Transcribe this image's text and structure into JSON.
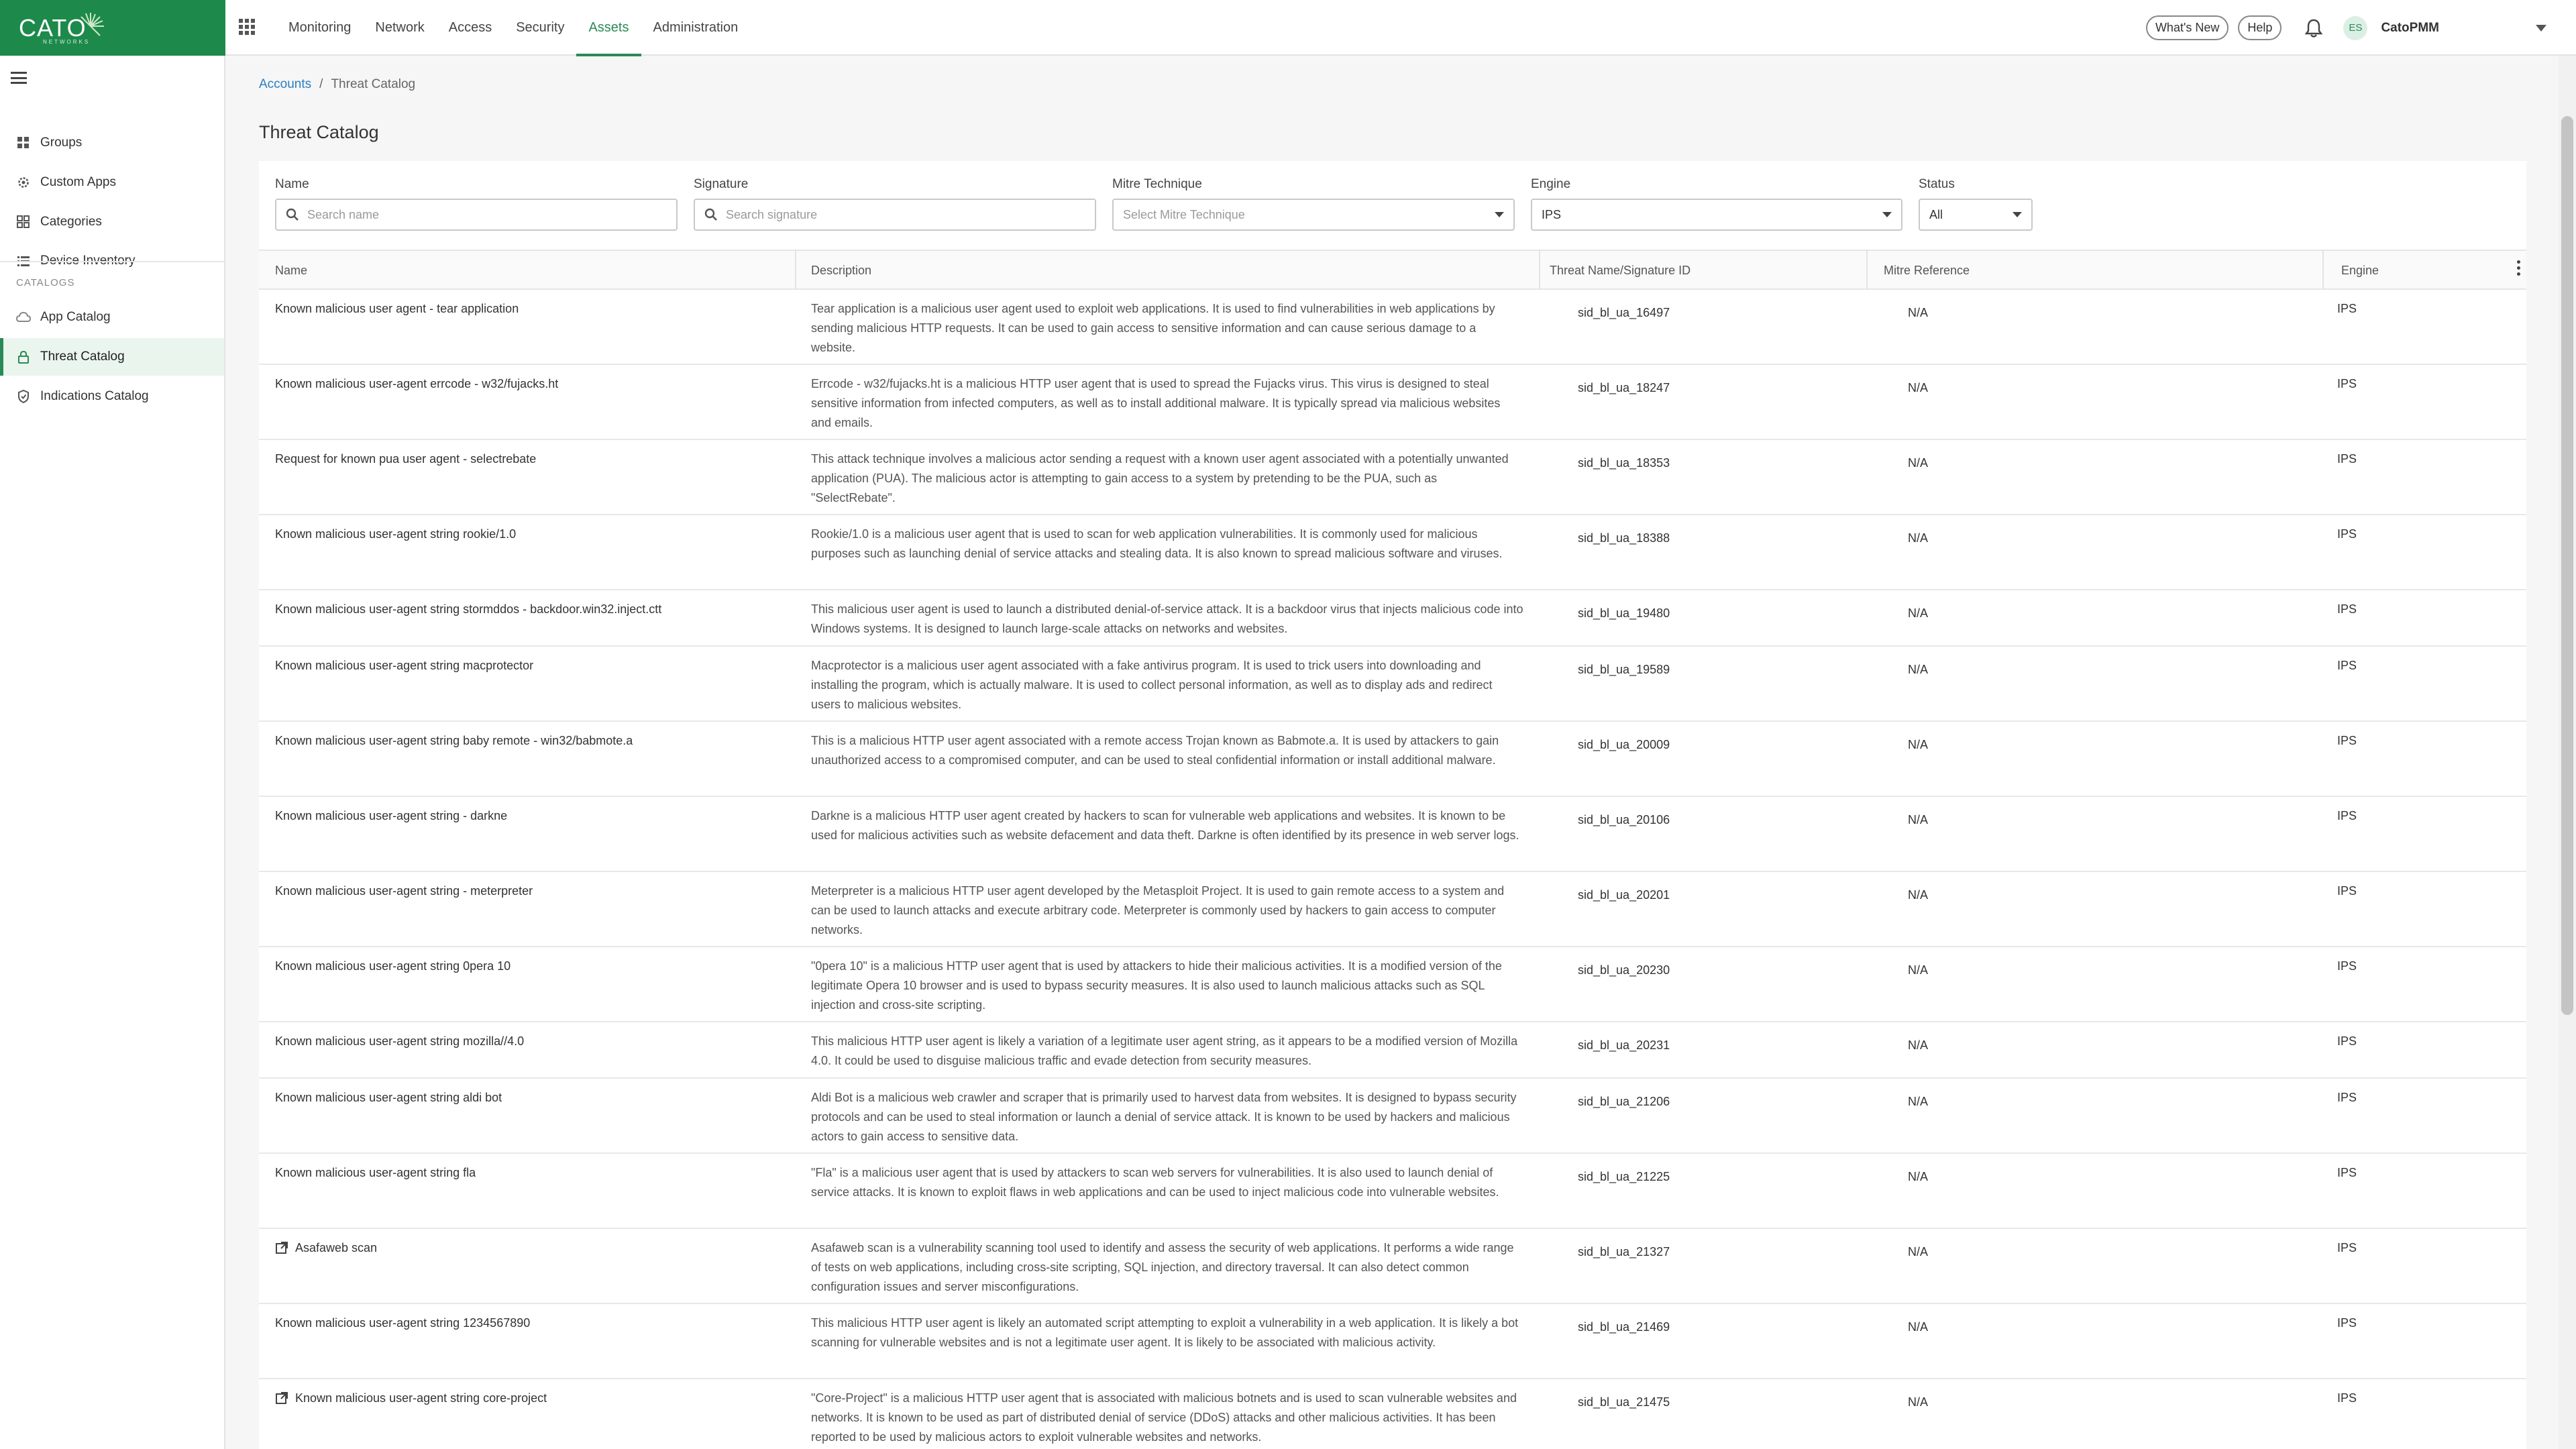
{
  "brand": {
    "logo_text": "CATO",
    "logo_subtext": "NETWORKS",
    "color": "#1d8a4b",
    "accent": "#2a8a57"
  },
  "topnav": [
    {
      "label": "Monitoring",
      "active": false
    },
    {
      "label": "Network",
      "active": false
    },
    {
      "label": "Access",
      "active": false
    },
    {
      "label": "Security",
      "active": false
    },
    {
      "label": "Assets",
      "active": true
    },
    {
      "label": "Administration",
      "active": false
    }
  ],
  "header_actions": {
    "whats_new": "What's New",
    "help": "Help",
    "avatar_initials": "ES",
    "account_name": "CatoPMM"
  },
  "sidebar": {
    "items": [
      {
        "label": "Groups",
        "icon": "grid-icon"
      },
      {
        "label": "Custom Apps",
        "icon": "gear-icon"
      },
      {
        "label": "Categories",
        "icon": "categories-icon"
      },
      {
        "label": "Device Inventory",
        "icon": "list-icon"
      }
    ],
    "section_label": "CATALOGS",
    "catalog_items": [
      {
        "label": "App Catalog",
        "icon": "cloud-icon",
        "active": false
      },
      {
        "label": "Threat Catalog",
        "icon": "lock-icon",
        "active": true
      },
      {
        "label": "Indications Catalog",
        "icon": "shield-check-icon",
        "active": false
      }
    ]
  },
  "breadcrumb": {
    "parent": "Accounts",
    "separator": "/",
    "current": "Threat Catalog"
  },
  "page_title": "Threat Catalog",
  "filters": {
    "name": {
      "label": "Name",
      "placeholder": "Search name"
    },
    "signature": {
      "label": "Signature",
      "placeholder": "Search signature"
    },
    "mitre": {
      "label": "Mitre Technique",
      "placeholder": "Select Mitre Technique"
    },
    "engine": {
      "label": "Engine",
      "value": "IPS"
    },
    "status": {
      "label": "Status",
      "value": "All"
    }
  },
  "table": {
    "columns": [
      "Name",
      "Description",
      "Threat Name/Signature ID",
      "Mitre Reference",
      "Engine"
    ],
    "rows": [
      {
        "name": "Known malicious user agent - tear application",
        "external": false,
        "description": "Tear application is a malicious user agent used to exploit web applications. It is used to find vulnerabilities in web applications by sending malicious HTTP requests. It can be used to gain access to sensitive information and can cause serious damage to a website.",
        "sig": "sid_bl_ua_16497",
        "mitre": "N/A",
        "engine": "IPS"
      },
      {
        "name": "Known malicious user-agent errcode - w32/fujacks.ht",
        "external": false,
        "description": "Errcode - w32/fujacks.ht is a malicious HTTP user agent that is used to spread the Fujacks virus. This virus is designed to steal sensitive information from infected computers, as well as to install additional malware. It is typically spread via malicious websites and emails.",
        "sig": "sid_bl_ua_18247",
        "mitre": "N/A",
        "engine": "IPS"
      },
      {
        "name": "Request for known pua user agent - selectrebate",
        "external": false,
        "description": "This attack technique involves a malicious actor sending a request with a known user agent associated with a potentially unwanted application (PUA). The malicious actor is attempting to gain access to a system by pretending to be the PUA, such as \"SelectRebate\".",
        "sig": "sid_bl_ua_18353",
        "mitre": "N/A",
        "engine": "IPS"
      },
      {
        "name": "Known malicious user-agent string rookie/1.0",
        "external": false,
        "description": "Rookie/1.0 is a malicious user agent that is used to scan for web application vulnerabilities. It is commonly used for malicious purposes such as launching denial of service attacks and stealing data. It is also known to spread malicious software and viruses.",
        "sig": "sid_bl_ua_18388",
        "mitre": "N/A",
        "engine": "IPS"
      },
      {
        "name": "Known malicious user-agent string stormddos - backdoor.win32.inject.ctt",
        "external": false,
        "description": "This malicious user agent is used to launch a distributed denial-of-service attack. It is a backdoor virus that injects malicious code into Windows systems. It is designed to launch large-scale attacks on networks and websites.",
        "sig": "sid_bl_ua_19480",
        "mitre": "N/A",
        "engine": "IPS"
      },
      {
        "name": "Known malicious user-agent string macprotector",
        "external": false,
        "description": "Macprotector is a malicious user agent associated with a fake antivirus program. It is used to trick users into downloading and installing the program, which is actually malware. It is used to collect personal information, as well as to display ads and redirect users to malicious websites.",
        "sig": "sid_bl_ua_19589",
        "mitre": "N/A",
        "engine": "IPS"
      },
      {
        "name": "Known malicious user-agent string baby remote - win32/babmote.a",
        "external": false,
        "description": "This is a malicious HTTP user agent associated with a remote access Trojan known as Babmote.a. It is used by attackers to gain unauthorized access to a compromised computer, and can be used to steal confidential information or install additional malware.",
        "sig": "sid_bl_ua_20009",
        "mitre": "N/A",
        "engine": "IPS"
      },
      {
        "name": "Known malicious user-agent string - darkne",
        "external": false,
        "description": "Darkne is a malicious HTTP user agent created by hackers to scan for vulnerable web applications and websites. It is known to be used for malicious activities such as website defacement and data theft. Darkne is often identified by its presence in web server logs.",
        "sig": "sid_bl_ua_20106",
        "mitre": "N/A",
        "engine": "IPS"
      },
      {
        "name": "Known malicious user-agent string - meterpreter",
        "external": false,
        "description": "Meterpreter is a malicious HTTP user agent developed by the Metasploit Project. It is used to gain remote access to a system and can be used to launch attacks and execute arbitrary code. Meterpreter is commonly used by hackers to gain access to computer networks.",
        "sig": "sid_bl_ua_20201",
        "mitre": "N/A",
        "engine": "IPS"
      },
      {
        "name": "Known malicious user-agent string 0pera 10",
        "external": false,
        "description": "\"0pera 10\" is a malicious HTTP user agent that is used by attackers to hide their malicious activities. It is a modified version of the legitimate Opera 10 browser and is used to bypass security measures. It is also used to launch malicious attacks such as SQL injection and cross-site scripting.",
        "sig": "sid_bl_ua_20230",
        "mitre": "N/A",
        "engine": "IPS"
      },
      {
        "name": "Known malicious user-agent string mozilla//4.0",
        "external": false,
        "description": "This malicious HTTP user agent is likely a variation of a legitimate user agent string, as it appears to be a modified version of Mozilla 4.0. It could be used to disguise malicious traffic and evade detection from security measures.",
        "sig": "sid_bl_ua_20231",
        "mitre": "N/A",
        "engine": "IPS"
      },
      {
        "name": "Known malicious user-agent string aldi bot",
        "external": false,
        "description": "Aldi Bot is a malicious web crawler and scraper that is primarily used to harvest data from websites. It is designed to bypass security protocols and can be used to steal information or launch a denial of service attack. It is known to be used by hackers and malicious actors to gain access to sensitive data.",
        "sig": "sid_bl_ua_21206",
        "mitre": "N/A",
        "engine": "IPS"
      },
      {
        "name": "Known malicious user-agent string fla",
        "external": false,
        "description": "\"Fla\" is a malicious user agent that is used by attackers to scan web servers for vulnerabilities. It is also used to launch denial of service attacks. It is known to exploit flaws in web applications and can be used to inject malicious code into vulnerable websites.",
        "sig": "sid_bl_ua_21225",
        "mitre": "N/A",
        "engine": "IPS"
      },
      {
        "name": "Asafaweb scan",
        "external": true,
        "description": "Asafaweb scan is a vulnerability scanning tool used to identify and assess the security of web applications. It performs a wide range of tests on web applications, including cross-site scripting, SQL injection, and directory traversal. It can also detect common configuration issues and server misconfigurations.",
        "sig": "sid_bl_ua_21327",
        "mitre": "N/A",
        "engine": "IPS"
      },
      {
        "name": "Known malicious user-agent string 1234567890",
        "external": false,
        "description": "This malicious HTTP user agent is likely an automated script attempting to exploit a vulnerability in a web application. It is likely a bot scanning for vulnerable websites and is not a legitimate user agent. It is likely to be associated with malicious activity.",
        "sig": "sid_bl_ua_21469",
        "mitre": "N/A",
        "engine": "IPS"
      },
      {
        "name": "Known malicious user-agent string core-project",
        "external": true,
        "description": "\"Core-Project\" is a malicious HTTP user agent that is associated with malicious botnets and is used to scan vulnerable websites and networks. It is known to be used as part of distributed denial of service (DDoS) attacks and other malicious activities. It has been reported to be used by malicious actors to exploit vulnerable websites and networks.",
        "sig": "sid_bl_ua_21475",
        "mitre": "N/A",
        "engine": "IPS"
      }
    ]
  }
}
